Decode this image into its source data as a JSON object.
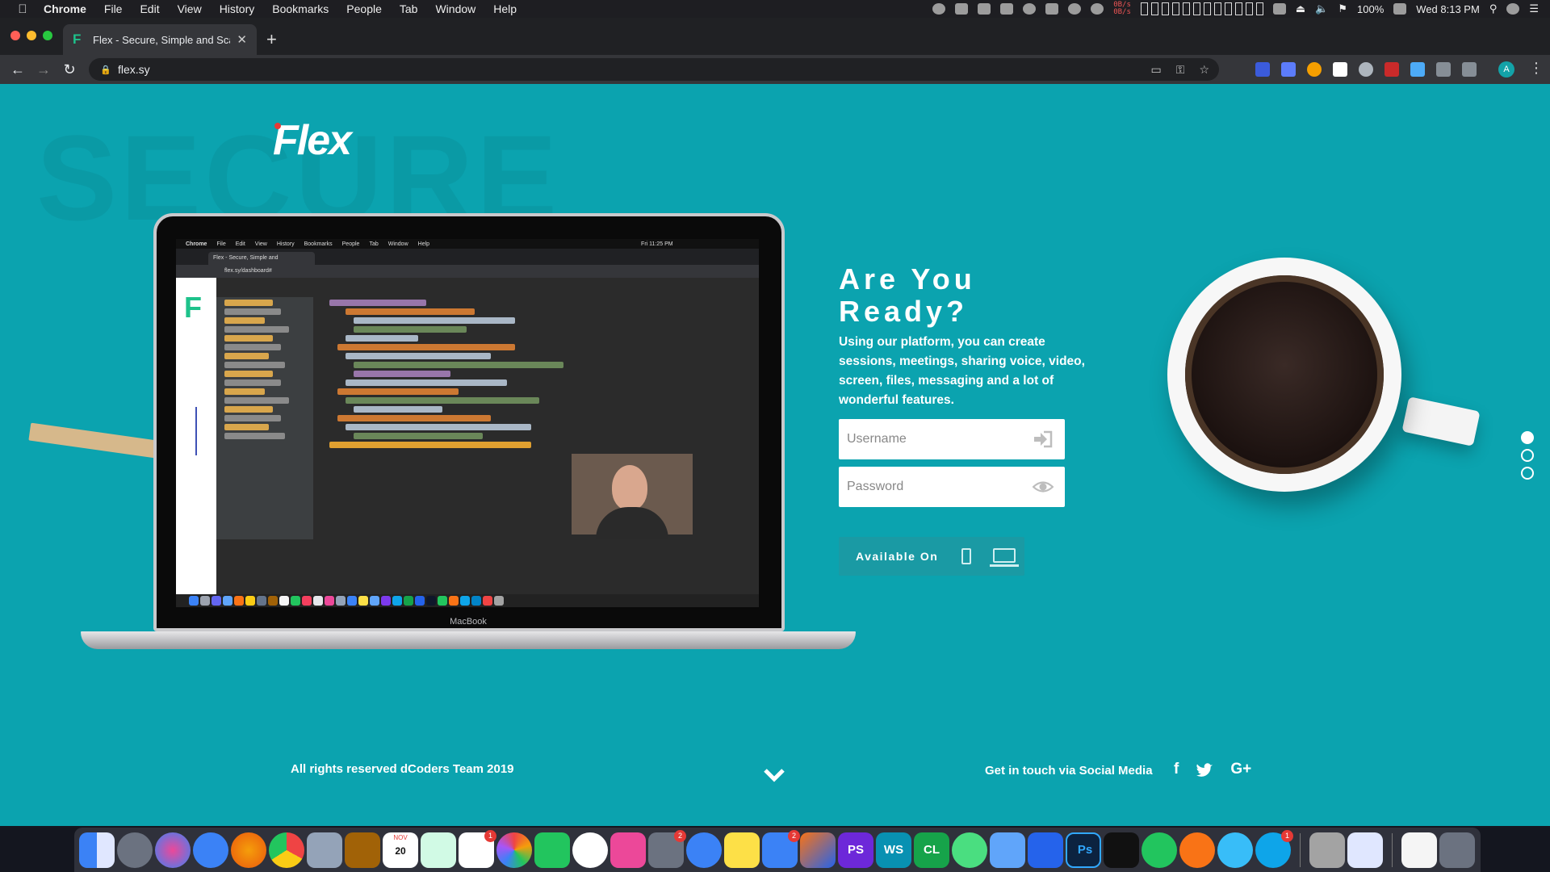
{
  "menubar": {
    "app": "Chrome",
    "items": [
      "File",
      "Edit",
      "View",
      "History",
      "Bookmarks",
      "People",
      "Tab",
      "Window",
      "Help"
    ],
    "net_tx": "0B/s",
    "net_rx": "0B/s",
    "battery": "100%",
    "clock": "Wed 8:13 PM"
  },
  "browser": {
    "tab_title": "Flex - Secure, Simple and Scal",
    "url": "flex.sy",
    "profile_initial": "A"
  },
  "page": {
    "bg_word": "SECURE",
    "logo": "Flex",
    "laptop_label": "MacBook",
    "mini_screen": {
      "menu": [
        "Chrome",
        "File",
        "Edit",
        "View",
        "History",
        "Bookmarks",
        "People",
        "Tab",
        "Window",
        "Help"
      ],
      "clock": "Fri 11:25 PM",
      "tab": "Flex - Secure, Simple and",
      "url": "flex.sy/dashboard#"
    },
    "headline": "Are You Ready?",
    "description": "Using our platform, you can create sessions, meetings, sharing voice, video, screen, files, messaging and a lot of wonderful features.",
    "username_placeholder": "Username",
    "password_placeholder": "Password",
    "available_on": "Available On",
    "footer_prefix": "All rights reserved",
    "footer_team": "dCoders Team",
    "footer_year": "2019",
    "social_text": "Get in touch via Social Media",
    "social": [
      "f",
      "t",
      "G+"
    ]
  },
  "colors": {
    "page_bg": "#0ba3af",
    "accent_green": "#1ec28b",
    "logo_dot": "#e53935"
  },
  "dock": {
    "calendar_month": "NOV",
    "calendar_day": "20",
    "badge_reminders": "1",
    "badge_sysprefs": "2",
    "badge_appstore": "2",
    "badge_skype": "1",
    "label_ps": "PS",
    "label_ws": "WS",
    "label_cl": "CL",
    "label_ps2": "Ps"
  }
}
